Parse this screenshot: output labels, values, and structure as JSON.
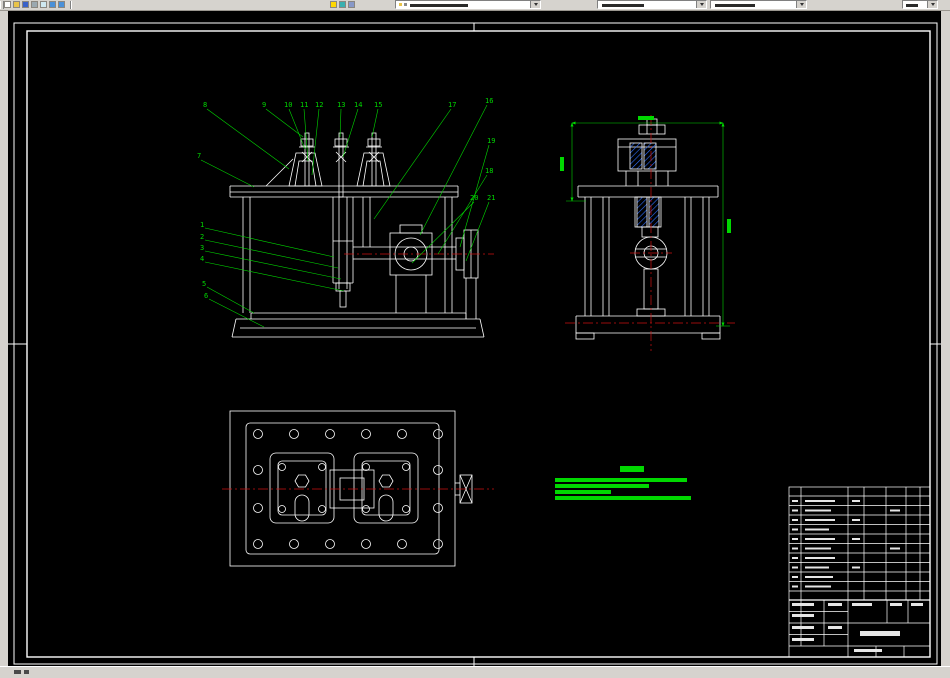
{
  "window": {
    "toolbar": {
      "icons": [
        "new-icon",
        "open-icon",
        "save-icon",
        "print-icon",
        "preview-icon",
        "undo-icon",
        "redo-icon",
        "lightning-icon",
        "layers-icon",
        "osnap-icon"
      ],
      "combos": [
        {
          "name": "layer-combo",
          "value": ""
        },
        {
          "name": "color-combo",
          "value": ""
        },
        {
          "name": "linetype-combo",
          "value": ""
        },
        {
          "name": "view-combo",
          "value": ""
        }
      ]
    }
  },
  "drawing": {
    "callouts": [
      "8",
      "9",
      "10",
      "11",
      "12",
      "13",
      "14",
      "15",
      "17",
      "16",
      "19",
      "18",
      "20",
      "21",
      "7",
      "1",
      "2",
      "3",
      "4",
      "5",
      "6"
    ],
    "views": [
      "front-view",
      "side-view",
      "plan-view"
    ],
    "colors": {
      "background": "#000000",
      "geometry": "#ffffff",
      "annotation": "#00d800",
      "centerline": "#cc1111",
      "hatch": "#2f6fff"
    }
  }
}
